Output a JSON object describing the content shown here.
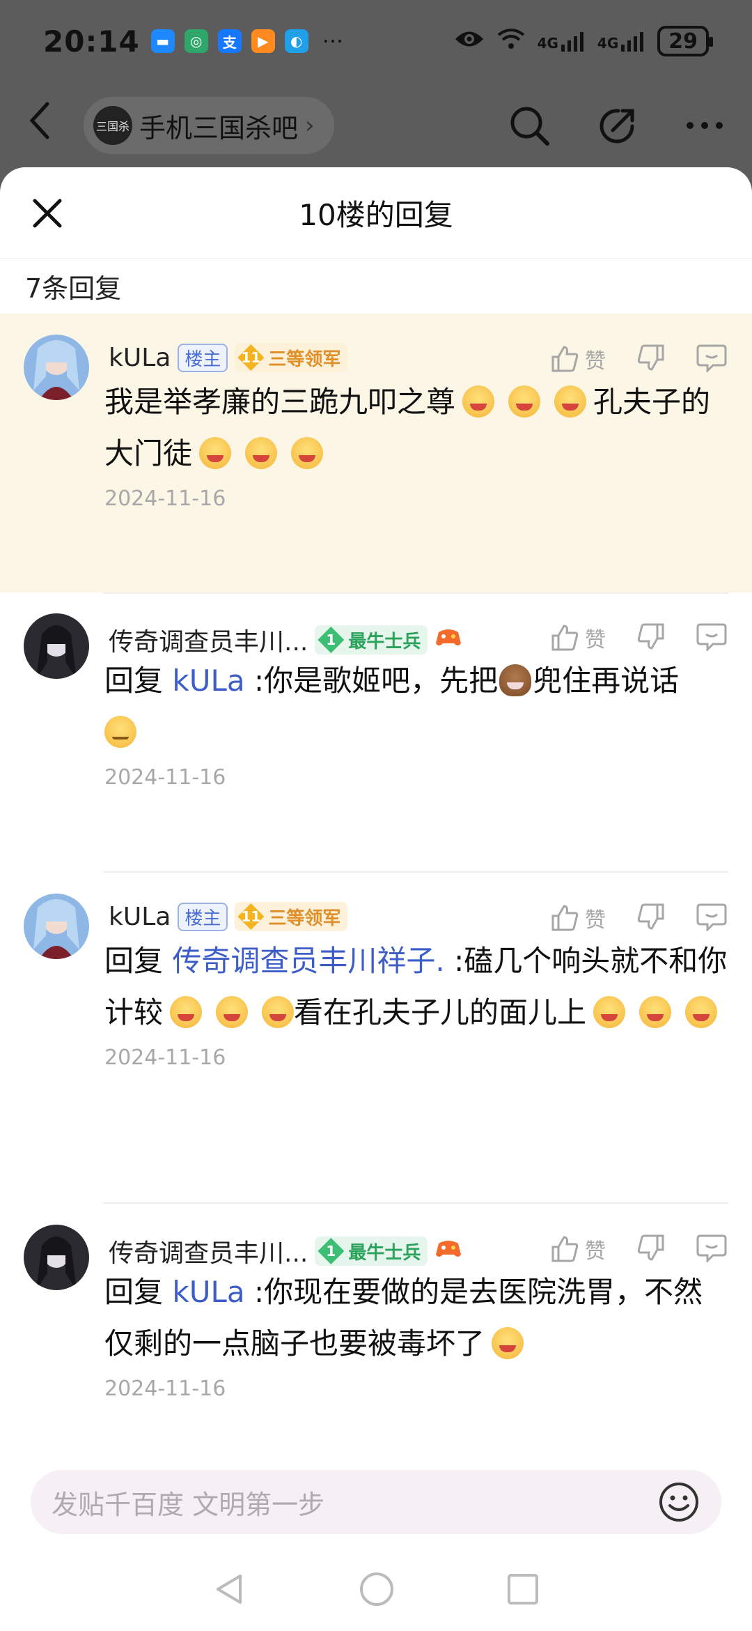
{
  "status_bar": {
    "time": "20:14",
    "more": "···",
    "signal1": "4G",
    "signal2": "4G",
    "battery": "29"
  },
  "top_nav": {
    "forum_name": "手机三国杀吧",
    "forum_logo_text": "三国杀"
  },
  "sheet": {
    "title": "10楼的回复",
    "reply_count": "7条回复"
  },
  "replies": [
    {
      "author": "kULa",
      "owner_tag": "楼主",
      "level_num": "11",
      "level_name": "三等领军",
      "like_label": "赞",
      "text_1": "我是举孝廉的三跪九叩之尊",
      "text_2": "孔夫子的大门徒",
      "date": "2024-11-16"
    },
    {
      "author": "传奇调查员丰川...",
      "level_num": "1",
      "level_name": "最牛士兵",
      "like_label": "赞",
      "prefix": "回复",
      "mention": "kULa",
      "text_1": ":你是歌姬吧，先把",
      "text_2": "兜住再说话",
      "date": "2024-11-16"
    },
    {
      "author": "kULa",
      "owner_tag": "楼主",
      "level_num": "11",
      "level_name": "三等领军",
      "like_label": "赞",
      "prefix": "回复",
      "mention": "传奇调查员丰川祥子.",
      "text_1": ":磕几个响头就不和你计较",
      "text_2": "看在孔夫子儿的面儿上",
      "date": "2024-11-16"
    },
    {
      "author": "传奇调查员丰川...",
      "level_num": "1",
      "level_name": "最牛士兵",
      "like_label": "赞",
      "prefix": "回复",
      "mention": "kULa",
      "text_1": ":你现在要做的是去医院洗胃，不然仅剩的一点脑子也要被毒坏了",
      "date": "2024-11-16"
    }
  ],
  "input": {
    "placeholder": "发贴千百度 文明第一步"
  },
  "colors": {
    "highlight_bg": "#fcf6e6",
    "mention": "#3d5ec9",
    "level_gold": "#e0902a",
    "level_green": "#2ca35c"
  }
}
